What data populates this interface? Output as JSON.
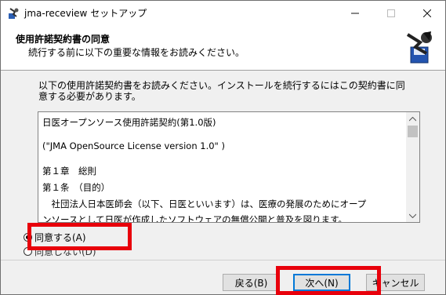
{
  "window": {
    "title": "jma-receview セットアップ"
  },
  "header": {
    "title": "使用許諾契約書の同意",
    "subtitle": "続行する前に以下の重要な情報をお読みください。"
  },
  "intro_text": "以下の使用許諾契約書をお読みください。インストールを続行するにはこの契約書に同意する必要があります。",
  "license": {
    "lines": [
      "日医オープンソース使用許諾契約(第1.0版)",
      "(\"JMA OpenSource License version 1.0\" )",
      "第１章　総則",
      "第１条　（目的）",
      "　社団法人日本医師会（以下、日医といいます）は、医療の発展のためにオープ",
      "ンソースとして日医が作成したソフトウェアの無償公開と普及を図ります。"
    ]
  },
  "options": {
    "agree": "同意する(A)",
    "disagree": "同意しない(D)",
    "selected": "agree"
  },
  "buttons": {
    "back": "戻る(B)",
    "next": "次へ(N)",
    "cancel": "キャンセル"
  },
  "colors": {
    "highlight": "#e8000b",
    "focus": "#0078d7"
  }
}
